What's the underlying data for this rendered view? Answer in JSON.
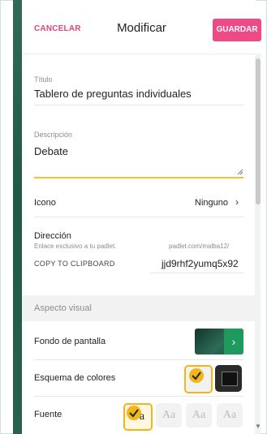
{
  "header": {
    "cancel_label": "CANCELAR",
    "title": "Modificar",
    "save_label": "GUARDAR",
    "accent_color": "#ee4a86"
  },
  "fields": {
    "title": {
      "label": "Título",
      "value": "Tablero de preguntas individuales"
    },
    "description": {
      "label": "Descripción",
      "value": "Debate"
    },
    "icon": {
      "label": "Icono",
      "value": "Ninguno"
    },
    "address": {
      "label": "Dirección",
      "hint": "Enlace exclusivo a tu padlet.",
      "url_prefix": "padlet.com/malba12/",
      "copy_label": "COPY TO CLIPBOARD",
      "slug": "jjd9rhf2yumq5x92"
    }
  },
  "appearance": {
    "section_label": "Aspecto visual",
    "wallpaper_label": "Fondo de pantalla",
    "color_scheme_label": "Esquema de colores",
    "font_label": "Fuente",
    "font_options": [
      "a",
      "Aa",
      "Aa",
      "Aa"
    ],
    "selected_color": "#f2b618"
  },
  "icons": [
    "chevron-right-icon",
    "check-icon",
    "resize-handle-icon",
    "scroll-down-icon"
  ]
}
